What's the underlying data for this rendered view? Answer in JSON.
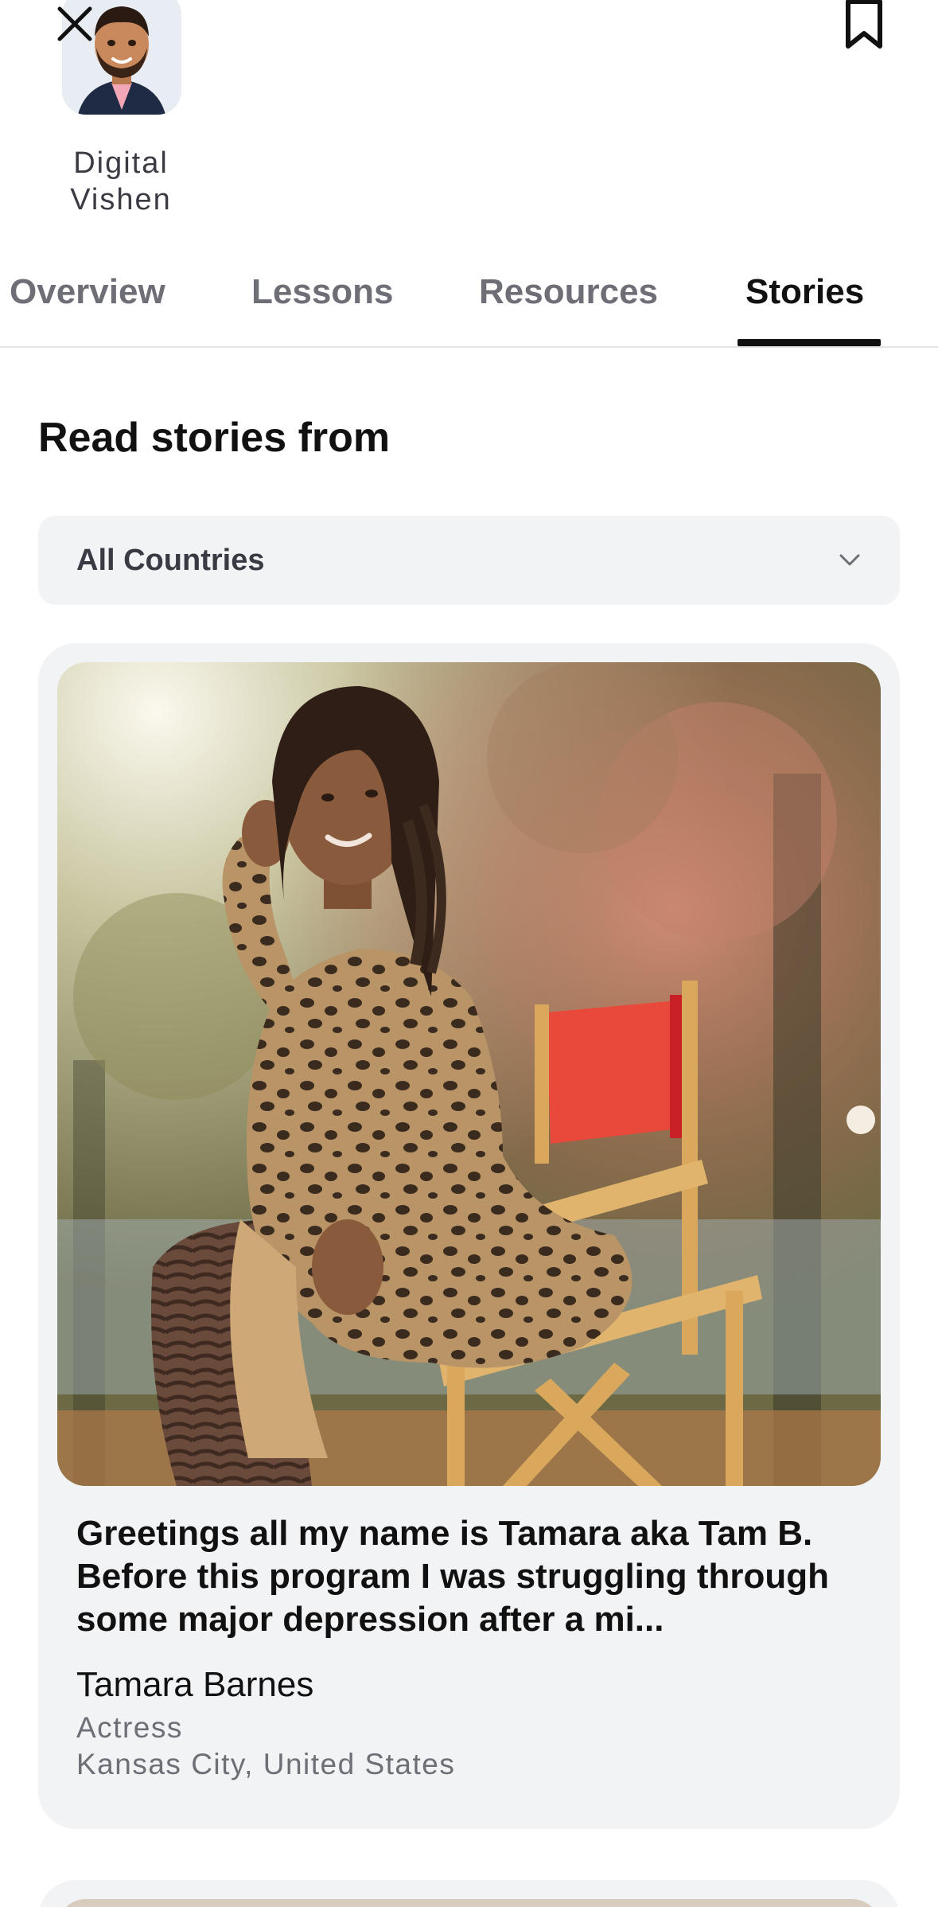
{
  "header": {
    "close_icon": "close-icon",
    "bookmark_icon": "bookmark-icon",
    "author_name": "Digital Vishen"
  },
  "tabs": [
    {
      "label": "Overview",
      "active": false
    },
    {
      "label": "Lessons",
      "active": false
    },
    {
      "label": "Resources",
      "active": false
    },
    {
      "label": "Stories",
      "active": true
    }
  ],
  "stories_section": {
    "heading": "Read stories from",
    "country_filter": {
      "value": "All Countries",
      "icon": "chevron-down-icon"
    },
    "stories": [
      {
        "excerpt": "Greetings all my name is Tamara aka Tam B. Before this program I was struggling through some major depression after a mi...",
        "name": "Tamara Barnes",
        "role": "Actress",
        "location": "Kansas City, United States"
      }
    ]
  },
  "colors": {
    "accent": "#111111",
    "muted_text": "#6e6e76",
    "card_background": "#f2f3f5",
    "chair_red": "#e0392c"
  }
}
